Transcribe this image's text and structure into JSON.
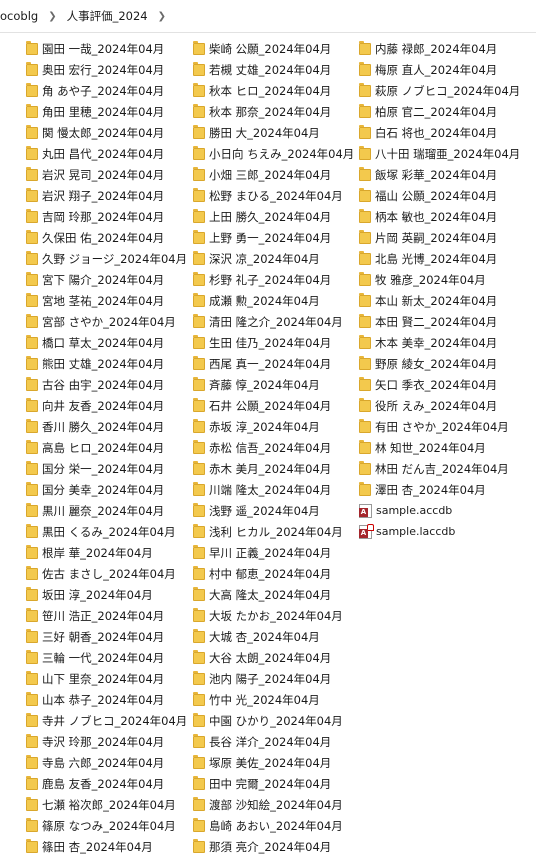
{
  "breadcrumb": {
    "items": [
      "ocoblg",
      "人事評価_2024"
    ]
  },
  "files": {
    "col1": [
      "園田 一哉_2024年04月",
      "奥田 宏行_2024年04月",
      "角 あや子_2024年04月",
      "角田 里穂_2024年04月",
      "関 慢太郎_2024年04月",
      "丸田 昌代_2024年04月",
      "岩沢 晃司_2024年04月",
      "岩沢 翔子_2024年04月",
      "吉岡 玲那_2024年04月",
      "久保田 佑_2024年04月",
      "久野 ジョージ_2024年04月",
      "宮下 陽介_2024年04月",
      "宮地 茎祐_2024年04月",
      "宮部 さやか_2024年04月",
      "橋口 草太_2024年04月",
      "熊田 丈雄_2024年04月",
      "古谷 由宇_2024年04月",
      "向井 友香_2024年04月",
      "香川 勝久_2024年04月",
      "高島 ヒロ_2024年04月",
      "国分 栄一_2024年04月",
      "国分 美幸_2024年04月",
      "黒川 麗奈_2024年04月",
      "黒田 くるみ_2024年04月",
      "根岸 華_2024年04月",
      "佐古 まさし_2024年04月",
      "坂田 淳_2024年04月",
      "笹川 浩正_2024年04月",
      "三好 朝香_2024年04月",
      "三輪 一代_2024年04月",
      "山下 里奈_2024年04月",
      "山本 恭子_2024年04月",
      "寺井 ノブヒコ_2024年04月",
      "寺沢 玲那_2024年04月",
      "寺島 六郎_2024年04月",
      "鹿島 友香_2024年04月",
      "七瀬 裕次郎_2024年04月",
      "篠原 なつみ_2024年04月",
      "篠田 杏_2024年04月"
    ],
    "col2": [
      "柴崎 公願_2024年04月",
      "若槻 丈雄_2024年04月",
      "秋本 ヒロ_2024年04月",
      "秋本 那奈_2024年04月",
      "勝田 大_2024年04月",
      "小日向 ちえみ_2024年04月",
      "小畑 三郎_2024年04月",
      "松野 まひる_2024年04月",
      "上田 勝久_2024年04月",
      "上野 勇一_2024年04月",
      "深沢 凉_2024年04月",
      "杉野 礼子_2024年04月",
      "成瀬 勲_2024年04月",
      "清田 隆之介_2024年04月",
      "生田 佳乃_2024年04月",
      "西尾 真一_2024年04月",
      "斉藤 惇_2024年04月",
      "石井 公願_2024年04月",
      "赤坂 淳_2024年04月",
      "赤松 信吾_2024年04月",
      "赤木 美月_2024年04月",
      "川端 隆太_2024年04月",
      "浅野 遥_2024年04月",
      "浅利 ヒカル_2024年04月",
      "早川 正義_2024年04月",
      "村中 郁恵_2024年04月",
      "大高 隆太_2024年04月",
      "大坂 たかお_2024年04月",
      "大城 杏_2024年04月",
      "大谷 太朗_2024年04月",
      "池内 陽子_2024年04月",
      "竹中 光_2024年04月",
      "中園 ひかり_2024年04月",
      "長谷 洋介_2024年04月",
      "塚原 美佐_2024年04月",
      "田中 完爾_2024年04月",
      "渡部 沙知絵_2024年04月",
      "島崎 あおい_2024年04月",
      "那須 亮介_2024年04月"
    ],
    "col3": [
      "内藤 禄郎_2024年04月",
      "梅原 直人_2024年04月",
      "萩原 ノブヒコ_2024年04月",
      "柏原 官二_2024年04月",
      "白石 将也_2024年04月",
      "八十田 瑞瑠亜_2024年04月",
      "飯塚 彩華_2024年04月",
      "福山 公願_2024年04月",
      "柄本 敏也_2024年04月",
      "片岡 英嗣_2024年04月",
      "北島 光博_2024年04月",
      "牧 雅彦_2024年04月",
      "本山 新太_2024年04月",
      "本田 賢二_2024年04月",
      "木本 美幸_2024年04月",
      "野原 綾女_2024年04月",
      "矢口 季衣_2024年04月",
      "役所 えみ_2024年04月",
      "有田 さやか_2024年04月",
      "林 知世_2024年04月",
      "林田 だん吉_2024年04月",
      "澤田 杏_2024年04月"
    ],
    "access_files": [
      "sample.accdb",
      "sample.laccdb"
    ]
  },
  "icons": {
    "folder": "folder-icon",
    "access_db": "access-database-icon",
    "access_lock": "access-lock-file-icon",
    "separator": "chevron-right-icon"
  },
  "colors": {
    "folder_fill": "#f3c94d",
    "access_red": "#a4262c"
  }
}
